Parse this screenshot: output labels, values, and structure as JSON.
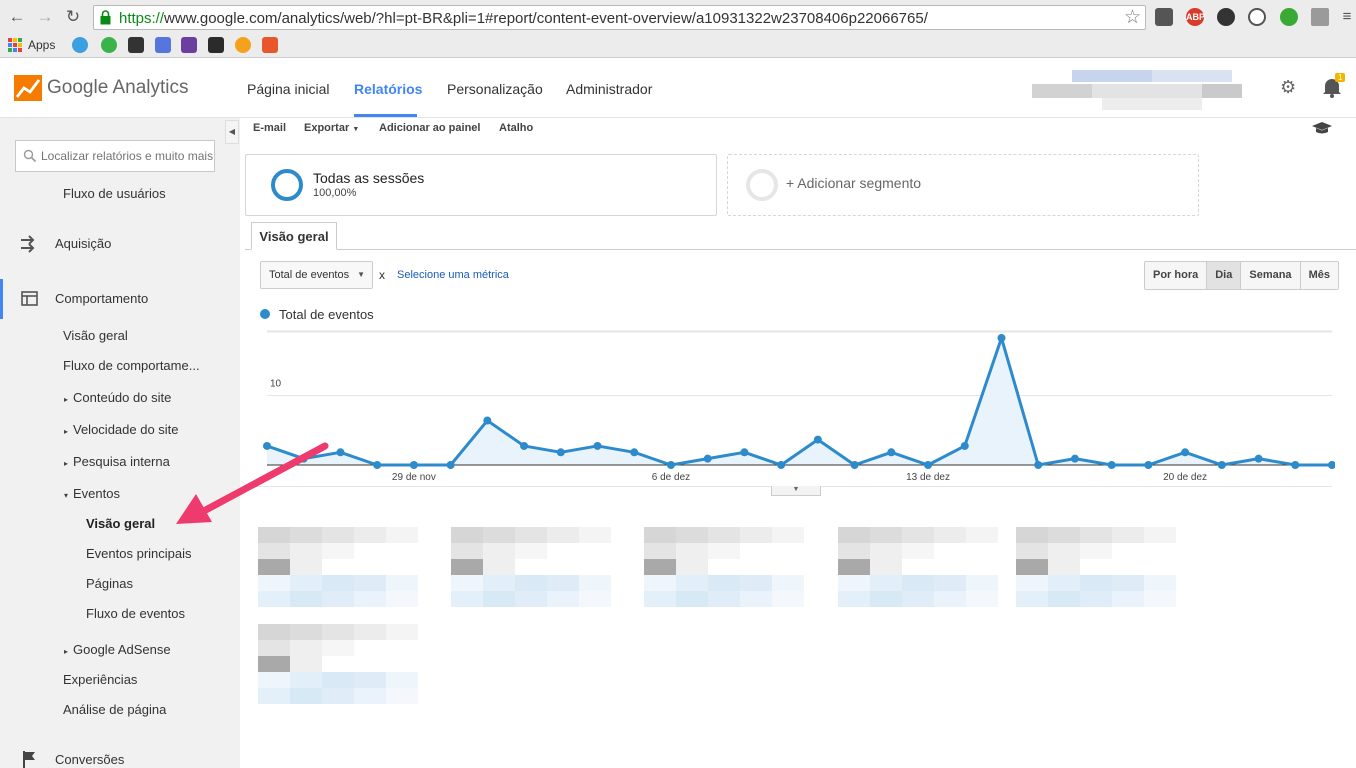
{
  "browser": {
    "url_scheme": "https://",
    "url_rest": "www.google.com/analytics/web/?hl=pt-BR&pli=1#report/content-event-overview/a10931322w23708406p22066765/",
    "apps_label": "Apps",
    "ext_labels": [
      "ABP"
    ]
  },
  "header": {
    "product_name": "Google Analytics",
    "nav": [
      "Página inicial",
      "Relatórios",
      "Personalização",
      "Administrador"
    ],
    "active_nav": "Relatórios",
    "notification_count": "1"
  },
  "sidebar": {
    "search_placeholder": "Localizar relatórios e muito mais",
    "items": [
      {
        "label": "Fluxo de usuários"
      },
      {
        "label": "Aquisição"
      },
      {
        "label": "Comportamento"
      },
      {
        "label": "Visão geral"
      },
      {
        "label": "Fluxo de comportame..."
      },
      {
        "label": "Conteúdo do site"
      },
      {
        "label": "Velocidade do site"
      },
      {
        "label": "Pesquisa interna"
      },
      {
        "label": "Eventos"
      },
      {
        "label": "Visão geral"
      },
      {
        "label": "Eventos principais"
      },
      {
        "label": "Páginas"
      },
      {
        "label": "Fluxo de eventos"
      },
      {
        "label": "Google AdSense"
      },
      {
        "label": "Experiências"
      },
      {
        "label": "Análise de página"
      },
      {
        "label": "Conversões"
      }
    ]
  },
  "toolbar": {
    "email": "E-mail",
    "export": "Exportar",
    "add_dashboard": "Adicionar ao painel",
    "shortcut": "Atalho"
  },
  "segments": {
    "current_label": "Todas as sessões",
    "current_pct": "100,00%",
    "add_label": "+ Adicionar segmento"
  },
  "tabs": {
    "overview": "Visão geral"
  },
  "controls": {
    "metric": "Total de eventos",
    "x_sep": "x",
    "select_metric": "Selecione uma métrica",
    "granularity": [
      "Por hora",
      "Dia",
      "Semana",
      "Mês"
    ],
    "granularity_selected": "Dia"
  },
  "colors": {
    "accent": "#4285f4",
    "series": "#2d8acb",
    "annotation_arrow": "#ee3a6d"
  },
  "chart_data": {
    "type": "area",
    "legend": [
      "Total de eventos"
    ],
    "y_ticks": [
      10,
      20
    ],
    "ylim": [
      0,
      20
    ],
    "x_tick_labels": [
      "29 de nov",
      "6 de dez",
      "13 de dez",
      "20 de dez"
    ],
    "x_tick_indices": [
      4,
      11,
      18,
      25
    ],
    "series": [
      {
        "name": "Total de eventos",
        "values": [
          3,
          1,
          2,
          0,
          0,
          0,
          7,
          3,
          2,
          3,
          2,
          0,
          1,
          2,
          0,
          4,
          0,
          2,
          0,
          3,
          20,
          0,
          1,
          0,
          0,
          2,
          0,
          1,
          0,
          0
        ]
      }
    ]
  }
}
